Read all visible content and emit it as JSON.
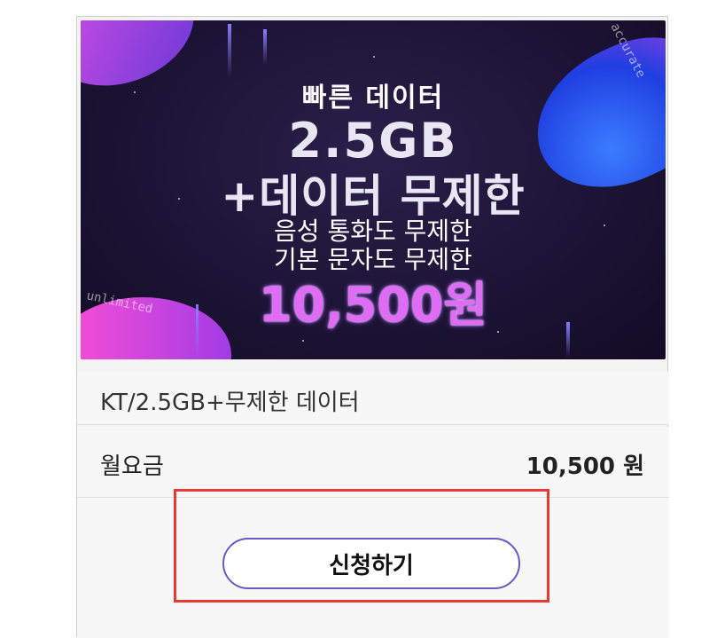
{
  "banner": {
    "line1": "빠른 데이터",
    "line2": "2.5GB",
    "line3": "+데이터 무제한",
    "line4": "음성 통화도 무제한",
    "line5": "기본 문자도 무제한",
    "line6": "10,500원",
    "deco_text_1": "d accurate",
    "deco_text_2": "unlimited"
  },
  "product": {
    "title": "KT/2.5GB+무제한 데이터",
    "fee_label": "월요금",
    "fee_value": "10,500 원",
    "apply_label": "신청하기"
  },
  "colors": {
    "button_border": "#6a58c4",
    "highlight": "#e53935",
    "banner_bg": "#1b1334"
  }
}
